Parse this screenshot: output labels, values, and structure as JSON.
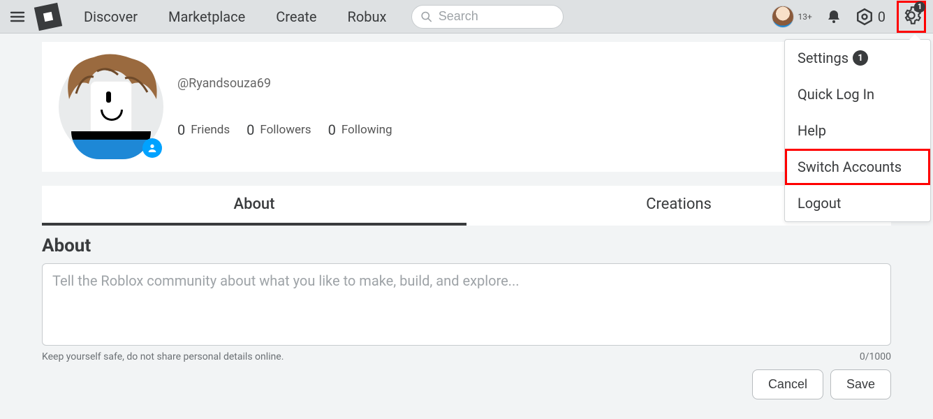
{
  "nav": {
    "links": [
      "Discover",
      "Marketplace",
      "Create",
      "Robux"
    ],
    "search_placeholder": "Search",
    "age_label": "13+",
    "robux_count": "0",
    "gear_badge": "1"
  },
  "dropdown": {
    "items": [
      {
        "label": "Settings",
        "badge": "1",
        "highlight": false
      },
      {
        "label": "Quick Log In",
        "highlight": false
      },
      {
        "label": "Help",
        "highlight": false
      },
      {
        "label": "Switch Accounts",
        "highlight": true
      },
      {
        "label": "Logout",
        "highlight": false
      }
    ]
  },
  "profile": {
    "username": "@Ryandsouza69",
    "stats": {
      "friends_count": "0",
      "friends_label": "Friends",
      "followers_count": "0",
      "followers_label": "Followers",
      "following_count": "0",
      "following_label": "Following"
    }
  },
  "tabs": {
    "about": "About",
    "creations": "Creations"
  },
  "about": {
    "heading": "About",
    "placeholder": "Tell the Roblox community about what you like to make, build, and explore...",
    "safety_note": "Keep yourself safe, do not share personal details online.",
    "char_counter": "0/1000",
    "cancel": "Cancel",
    "save": "Save"
  }
}
